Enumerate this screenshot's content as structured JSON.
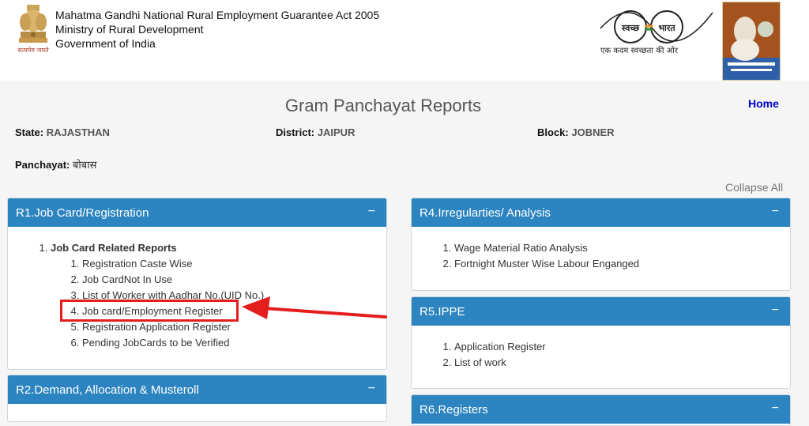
{
  "header": {
    "line1": "Mahatma Gandhi National Rural Employment Guarantee Act 2005",
    "line2": "Ministry of Rural Development",
    "line3": "Government of India",
    "emblem_motto": "सत्यमेव जयते",
    "swachh_left": "स्वच्छ",
    "swachh_right": "भारत",
    "swachh_tagline": "एक कदम स्वच्छता की ओर"
  },
  "page": {
    "title": "Gram Panchayat Reports",
    "home_label": "Home",
    "collapse_all_label": "Collapse All"
  },
  "info": {
    "state_label": "State:",
    "state_value": "RAJASTHAN",
    "district_label": "District:",
    "district_value": "JAIPUR",
    "block_label": "Block:",
    "block_value": "JOBNER",
    "panchayat_label": "Panchayat:",
    "panchayat_value": "बोबास"
  },
  "panels": {
    "r1": {
      "title": "R1.Job Card/Registration",
      "toggle": "−",
      "group": "Job Card Related Reports",
      "items": [
        "Registration Caste Wise",
        "Job CardNot In Use",
        "List of Worker with Aadhar No.(UID No.)",
        "Job card/Employment Register",
        "Registration Application Register",
        "Pending JobCards to be Verified"
      ]
    },
    "r2": {
      "title": "R2.Demand, Allocation & Musteroll",
      "toggle": "−"
    },
    "r4": {
      "title": "R4.Irregularties/ Analysis",
      "toggle": "−",
      "items": [
        "Wage Material Ratio Analysis",
        "Fortnight Muster Wise Labour Enganged"
      ]
    },
    "r5": {
      "title": "R5.IPPE",
      "toggle": "−",
      "items": [
        "Application Register",
        "List of work"
      ]
    },
    "r6": {
      "title": "R6.Registers",
      "toggle": "−"
    }
  },
  "colors": {
    "panel_header": "#2c84c0",
    "annotation": "#e41d1d",
    "home_link": "#0000cc"
  }
}
